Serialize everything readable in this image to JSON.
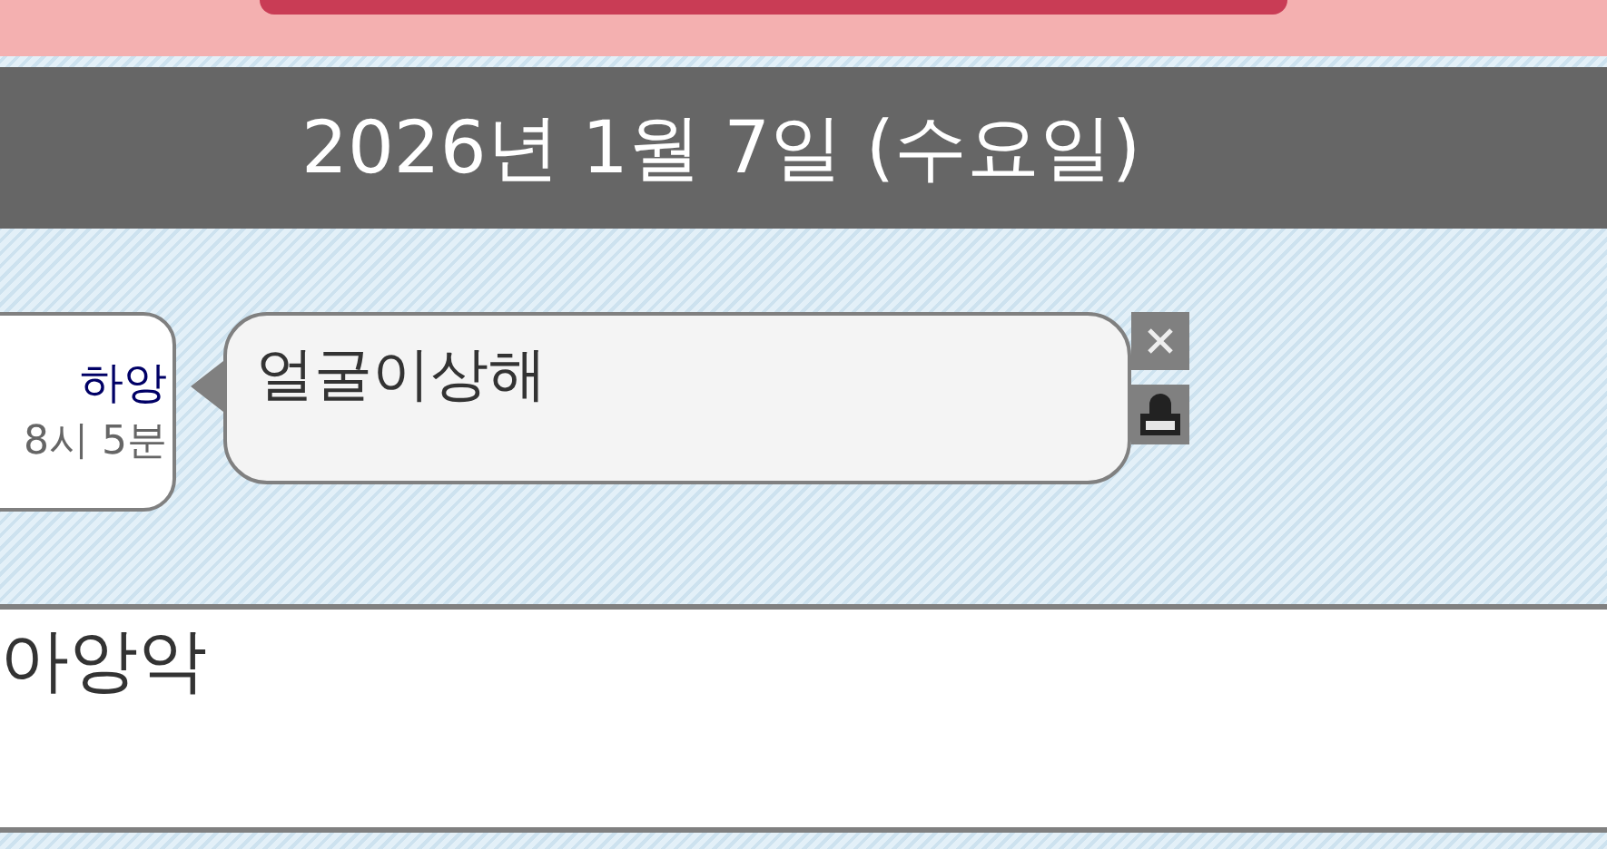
{
  "date_header": "2026년 1월 7일 (수요일)",
  "sender": {
    "name": "하앙",
    "time": "8시 5분"
  },
  "message": {
    "text": "얼굴이상해"
  },
  "input": {
    "value": "아앙악"
  }
}
